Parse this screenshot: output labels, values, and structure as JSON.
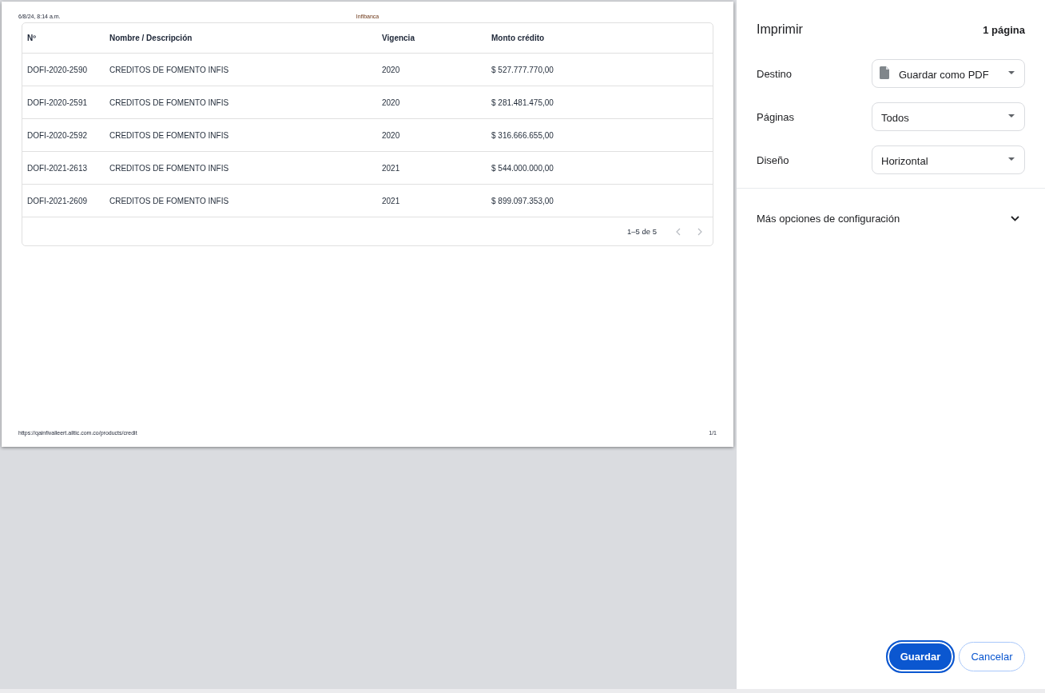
{
  "preview": {
    "page": {
      "header": {
        "date": "6/8/24, 8:14 a.m.",
        "title": "Infibanca"
      },
      "table": {
        "columns": [
          "Nº",
          "Nombre / Descripción",
          "Vigencia",
          "Monto crédito"
        ],
        "rows": [
          [
            "DOFI-2020-2590",
            "CREDITOS DE FOMENTO INFIS",
            "2020",
            "$ 527.777.770,00"
          ],
          [
            "DOFI-2020-2591",
            "CREDITOS DE FOMENTO INFIS",
            "2020",
            "$ 281.481.475,00"
          ],
          [
            "DOFI-2020-2592",
            "CREDITOS DE FOMENTO INFIS",
            "2020",
            "$ 316.666.655,00"
          ],
          [
            "DOFI-2021-2613",
            "CREDITOS DE FOMENTO INFIS",
            "2021",
            "$ 544.000.000,00"
          ],
          [
            "DOFI-2021-2609",
            "CREDITOS DE FOMENTO INFIS",
            "2021",
            "$ 899.097.353,00"
          ]
        ],
        "pagination": {
          "range": "1–5 de 5",
          "controls": [
            {
              "kind": "previous",
              "disabled": true
            },
            {
              "kind": "next",
              "disabled": true
            }
          ]
        }
      },
      "footer": {
        "url": "https://qainfivalleert.alltic.com.co/products/credit",
        "page": "1/1"
      }
    }
  },
  "print_panel": {
    "title": "Imprimir",
    "page_count": "1 página",
    "settings": [
      {
        "label": "Destino",
        "value": "Guardar como PDF",
        "kind": "destination"
      },
      {
        "label": "Páginas",
        "value": "Todos",
        "kind": "select"
      },
      {
        "label": "Diseño",
        "value": "Horizontal",
        "kind": "select"
      }
    ],
    "more_options": {
      "label": "Más opciones de configuración",
      "expanded": false
    },
    "buttons": [
      {
        "label": "Guardar",
        "kind": "primary",
        "focused": true
      },
      {
        "label": "Cancelar",
        "kind": "secondary",
        "focused": false
      }
    ]
  }
}
